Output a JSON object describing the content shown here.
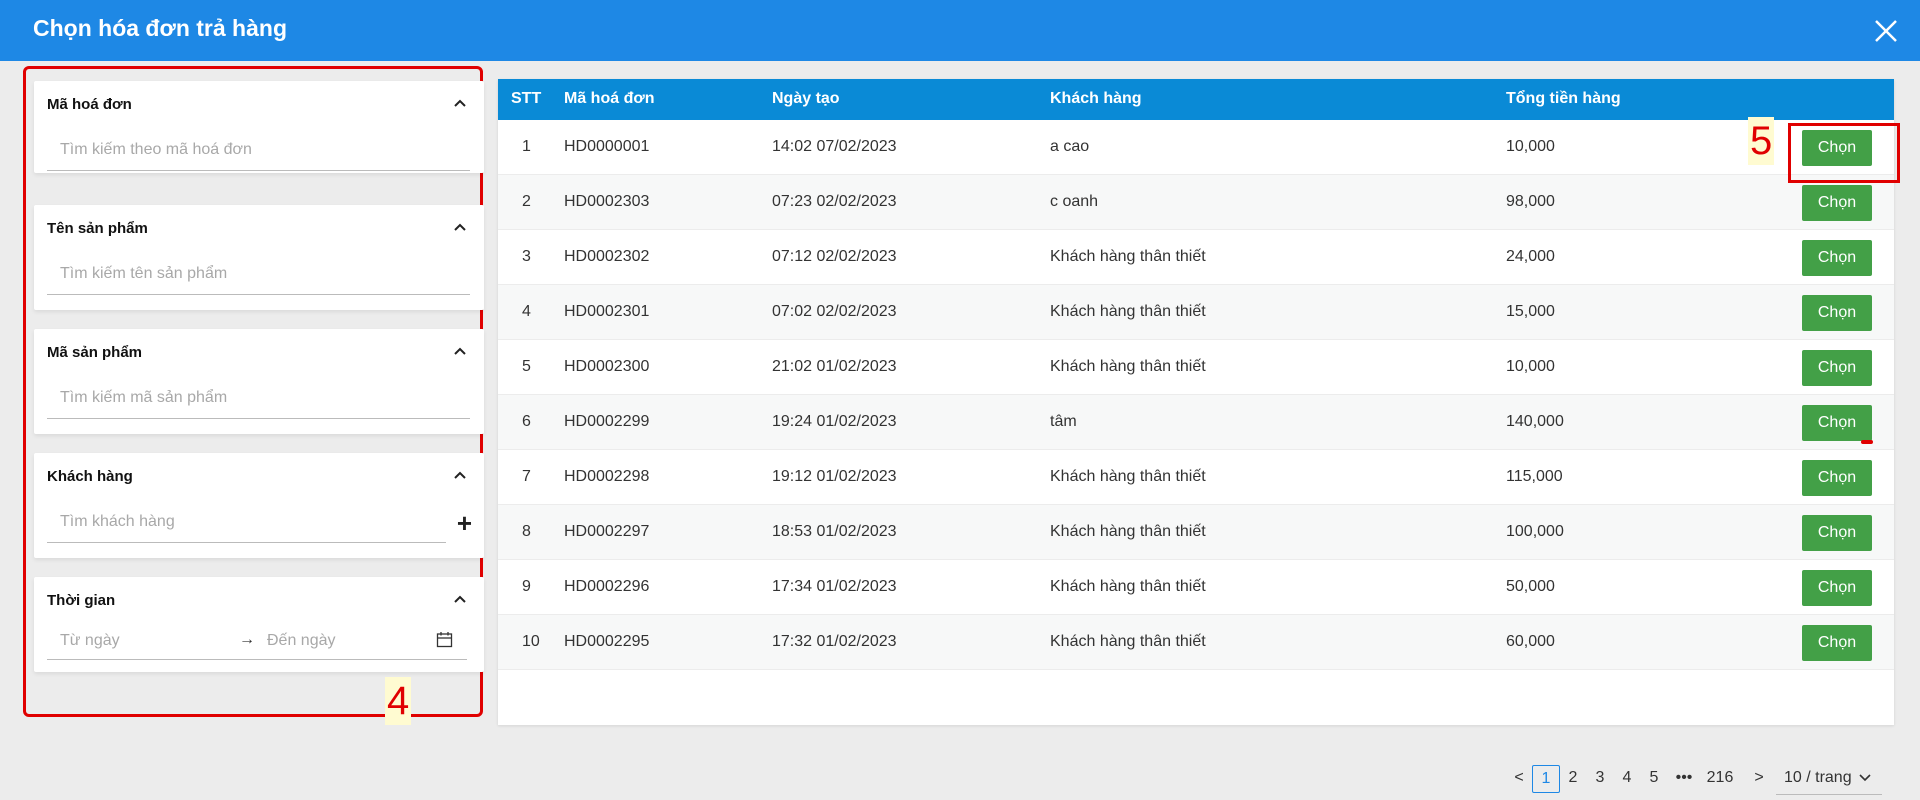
{
  "header": {
    "title": "Chọn hóa đơn trả hàng"
  },
  "filters": {
    "invoice_code": {
      "label": "Mã hoá đơn",
      "placeholder": "Tìm kiếm theo mã hoá đơn"
    },
    "product_name": {
      "label": "Tên sản phẩm",
      "placeholder": "Tìm kiếm tên sản phẩm"
    },
    "product_code": {
      "label": "Mã sản phẩm",
      "placeholder": "Tìm kiếm mã sản phẩm"
    },
    "customer": {
      "label": "Khách hàng",
      "placeholder": "Tìm khách hàng",
      "add_symbol": "+"
    },
    "time": {
      "label": "Thời gian",
      "from_placeholder": "Từ ngày",
      "arrow": "→",
      "to_placeholder": "Đến ngày"
    }
  },
  "annotations": {
    "left_label": "4",
    "right_label": "5"
  },
  "table": {
    "columns": [
      "STT",
      "Mã hoá đơn",
      "Ngày tạo",
      "Khách hàng",
      "Tổng tiền hàng"
    ],
    "button_label": "Chọn",
    "rows": [
      [
        "1",
        "HD0000001",
        "14:02 07/02/2023",
        "a cao",
        "10,000"
      ],
      [
        "2",
        "HD0002303",
        "07:23 02/02/2023",
        "c oanh",
        "98,000"
      ],
      [
        "3",
        "HD0002302",
        "07:12 02/02/2023",
        "Khách hàng thân thiết",
        "24,000"
      ],
      [
        "4",
        "HD0002301",
        "07:02 02/02/2023",
        "Khách hàng thân thiết",
        "15,000"
      ],
      [
        "5",
        "HD0002300",
        "21:02 01/02/2023",
        "Khách hàng thân thiết",
        "10,000"
      ],
      [
        "6",
        "HD0002299",
        "19:24 01/02/2023",
        "tâm",
        "140,000"
      ],
      [
        "7",
        "HD0002298",
        "19:12 01/02/2023",
        "Khách hàng thân thiết",
        "115,000"
      ],
      [
        "8",
        "HD0002297",
        "18:53 01/02/2023",
        "Khách hàng thân thiết",
        "100,000"
      ],
      [
        "9",
        "HD0002296",
        "17:34 01/02/2023",
        "Khách hàng thân thiết",
        "50,000"
      ],
      [
        "10",
        "HD0002295",
        "17:32 01/02/2023",
        "Khách hàng thân thiết",
        "60,000"
      ]
    ]
  },
  "pagination": {
    "prev": "<",
    "pages": [
      "1",
      "2",
      "3",
      "4",
      "5"
    ],
    "current": "1",
    "ellipsis": "•••",
    "last": "216",
    "next": ">",
    "page_size": "10 / trang"
  },
  "colors": {
    "header": "#1e88e5",
    "table_header": "#0a8ad6",
    "button": "#43a047",
    "annotation": "#e00000"
  }
}
